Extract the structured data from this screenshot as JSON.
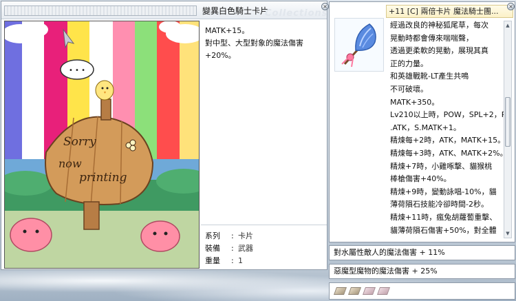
{
  "card_window": {
    "title": "變異白色騎士卡片",
    "watermark": "Collections",
    "description": [
      "MATK+15。",
      "對中型、大型對象的魔法傷害",
      "+20%。"
    ],
    "art_text": {
      "sign_line1": "Sorry",
      "sign_line2": "now",
      "sign_line3": "printing",
      "bubble": "• • •"
    },
    "properties": [
      {
        "key": "系列",
        "sep": ":",
        "value": "卡片"
      },
      {
        "key": "裝備",
        "sep": ":",
        "value": "武器"
      },
      {
        "key": "重量",
        "sep": ":",
        "value": "1"
      }
    ]
  },
  "item_window": {
    "title": "+11 [C] 兩倍卡片 魔法騎士團...",
    "description": [
      "經過改良的神秘狐尾草，每次",
      "晃動時都會傳來喘喘聲，",
      "透過更柔軟的晃動，展現其真",
      "正的力量。",
      "和英雄戰靴-LT產生共鳴",
      "不可破壞。",
      "MATK+350。",
      "Lv210以上時，POW，SPL+2，P",
      ".ATK，S.MATK+1。",
      "精煉每+2時，ATK，MATK+15。",
      "精煉每+3時，ATK、MATK+2%。",
      "精煉+7時，小雞啄擊、貓猴桃",
      "棒槍傷害+40%。",
      "精煉+9時，變動詠唱-10%，貓",
      "薄荷隕石技能冷卻時間-2秒。",
      "精煉+11時，瘋兔胡蘿蔔重擊、",
      "貓薄荷隕石傷害+50%，對全體"
    ],
    "options": [
      "對水屬性敵人的魔法傷害 + 11%",
      "惡魔型魔物的魔法傷害 + 25%"
    ],
    "slots": [
      "filled",
      "filled",
      "empty",
      "empty"
    ],
    "scroll": {
      "up": "▲",
      "down": "▼",
      "position": 0.45
    }
  },
  "icons": {
    "close": "close-icon",
    "item": "blue-foxtail-wand-icon"
  },
  "colors": {
    "title_highlight": "#fbf1c8",
    "window_border": "#8e9aa8"
  }
}
